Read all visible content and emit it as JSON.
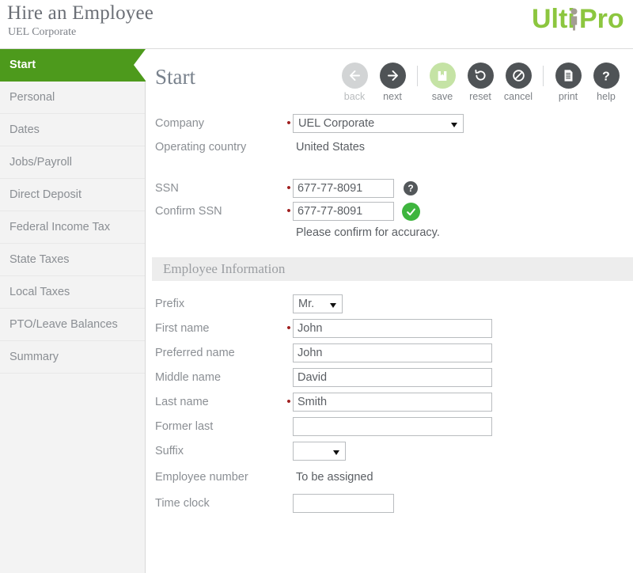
{
  "header": {
    "title": "Hire an Employee",
    "subtitle": "UEL Corporate",
    "logo": {
      "part1": "Ulti",
      "part2": "Pro",
      "alt": "UltiPro"
    }
  },
  "sidebar": {
    "items": [
      {
        "label": "Start",
        "active": true
      },
      {
        "label": "Personal",
        "active": false
      },
      {
        "label": "Dates",
        "active": false
      },
      {
        "label": "Jobs/Payroll",
        "active": false
      },
      {
        "label": "Direct Deposit",
        "active": false
      },
      {
        "label": "Federal Income Tax",
        "active": false
      },
      {
        "label": "State Taxes",
        "active": false
      },
      {
        "label": "Local Taxes",
        "active": false
      },
      {
        "label": "PTO/Leave Balances",
        "active": false
      },
      {
        "label": "Summary",
        "active": false
      }
    ]
  },
  "main": {
    "page_title": "Start",
    "toolbar": [
      {
        "label": "back",
        "icon": "arrow-left-icon",
        "state": "disabled"
      },
      {
        "label": "next",
        "icon": "arrow-right-icon",
        "state": "enabled"
      },
      {
        "label": "save",
        "icon": "save-disk-icon",
        "state": "green"
      },
      {
        "label": "reset",
        "icon": "undo-icon",
        "state": "enabled"
      },
      {
        "label": "cancel",
        "icon": "no-entry-icon",
        "state": "enabled"
      },
      {
        "label": "print",
        "icon": "printer-page-icon",
        "state": "enabled"
      },
      {
        "label": "help",
        "icon": "question-icon",
        "state": "enabled"
      }
    ],
    "fields": {
      "company": {
        "label": "Company",
        "value": "UEL Corporate",
        "required": true
      },
      "operating_country": {
        "label": "Operating country",
        "value": "United States",
        "required": false
      },
      "ssn": {
        "label": "SSN",
        "value": "677-77-8091",
        "required": true,
        "help_icon": "question-mark-icon"
      },
      "confirm_ssn": {
        "label": "Confirm SSN",
        "value": "677-77-8091",
        "required": true,
        "valid_icon": "green-check-icon",
        "note": "Please confirm for accuracy."
      }
    },
    "section": {
      "title": "Employee Information"
    },
    "employee": {
      "prefix": {
        "label": "Prefix",
        "value": "Mr.",
        "required": false
      },
      "first_name": {
        "label": "First name",
        "value": "John",
        "required": true
      },
      "preferred_name": {
        "label": "Preferred name",
        "value": "John",
        "required": false
      },
      "middle_name": {
        "label": "Middle name",
        "value": "David",
        "required": false
      },
      "last_name": {
        "label": "Last name",
        "value": "Smith",
        "required": true
      },
      "former_last": {
        "label": "Former last",
        "value": "",
        "required": false
      },
      "suffix": {
        "label": "Suffix",
        "value": "",
        "required": false
      },
      "employee_number": {
        "label": "Employee number",
        "value": "To be assigned",
        "required": false
      },
      "time_clock": {
        "label": "Time clock",
        "value": "",
        "required": false
      }
    }
  },
  "colors": {
    "brand_green": "#4d9a1c",
    "logo_green": "#8cc63f",
    "logo_figure": "#a39d93",
    "required_red": "#a02020",
    "toolbar_dark": "#4f5356",
    "save_green": "#c5e3a5",
    "check_green": "#3eb53e"
  }
}
